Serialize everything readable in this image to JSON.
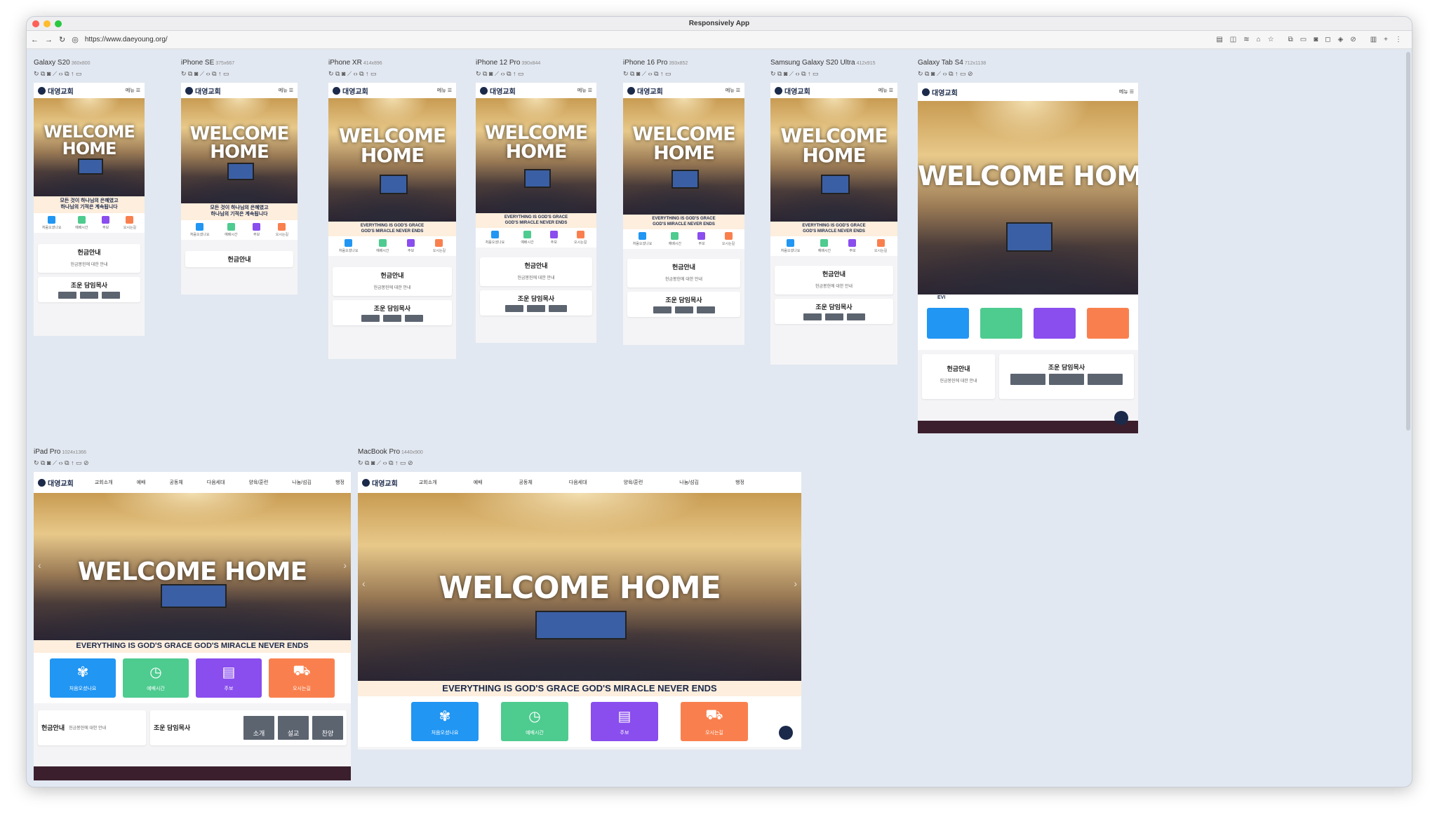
{
  "app": {
    "title": "Responsively App",
    "url": "https://www.daeyoung.org/"
  },
  "colors": {
    "blue": "#2196f3",
    "green": "#4ecb8f",
    "purple": "#8a4dee",
    "orange": "#f9804e",
    "navy": "#1b2a4a",
    "tagline_bg": "#fdeedd"
  },
  "site": {
    "logo": "대영교회",
    "menu": "메뉴",
    "welcome": "WELCOME HOME",
    "welcome_line1": "WELCOME",
    "welcome_line2": "HOME",
    "tagline_ko_1": "모든 것이 하나님의 은혜였고",
    "tagline_ko_2": "하나님의 기적은 계속됩니다",
    "tagline_en": "EVERYTHING IS GOD'S GRACE GOD'S MIRACLE NEVER ENDS",
    "tagline_en_1": "EVERYTHING IS GOD'S GRACE",
    "tagline_en_2": "GOD'S MIRACLE NEVER ENDS",
    "quick": [
      "처음오셨나요",
      "예배시간",
      "주보",
      "오시는길"
    ],
    "offering_title": "헌금안내",
    "offering_desc": "헌금봉헌에 대한 안내",
    "pastor_title": "조운 담임목사",
    "pastor_btns": [
      "소개",
      "설교",
      "찬양"
    ],
    "nav": [
      "교회소개",
      "예배",
      "공동체",
      "다음세대",
      "양육/훈련",
      "나눔/섬김",
      "행정"
    ],
    "tab_fragment": "EVI"
  },
  "devices": [
    {
      "name": "Galaxy S20",
      "size": "360x800"
    },
    {
      "name": "iPhone SE",
      "size": "375x667"
    },
    {
      "name": "iPhone XR",
      "size": "414x896"
    },
    {
      "name": "iPhone 12 Pro",
      "size": "390x844"
    },
    {
      "name": "iPhone 16 Pro",
      "size": "393x852"
    },
    {
      "name": "Samsung Galaxy S20 Ultra",
      "size": "412x915"
    },
    {
      "name": "Galaxy Tab S4",
      "size": "712x1138"
    },
    {
      "name": "iPad Pro",
      "size": "1024x1366"
    },
    {
      "name": "MacBook Pro",
      "size": "1440x900"
    }
  ]
}
